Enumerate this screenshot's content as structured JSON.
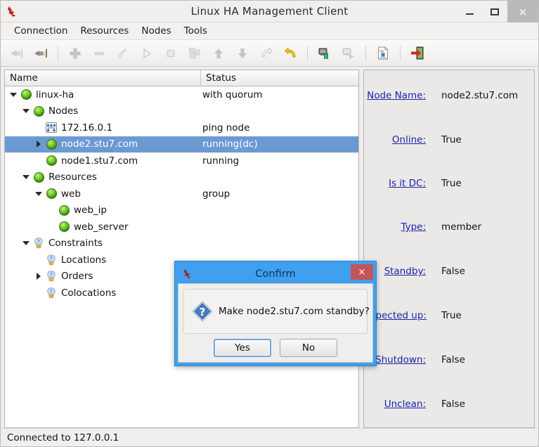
{
  "window": {
    "title": "Linux HA Management Client",
    "app_icon": "linux-ha-icon",
    "minimize_label": "–",
    "maximize_label": "□",
    "close_label": "×"
  },
  "menubar": {
    "items": [
      {
        "label": "Connection"
      },
      {
        "label": "Resources"
      },
      {
        "label": "Nodes"
      },
      {
        "label": "Tools"
      }
    ]
  },
  "toolbar": {
    "buttons": [
      {
        "name": "connect-icon",
        "enabled": false
      },
      {
        "name": "disconnect-icon",
        "enabled": true
      },
      {
        "name": "separator-1",
        "separator": true
      },
      {
        "name": "add-icon",
        "enabled": true
      },
      {
        "name": "remove-icon",
        "enabled": false
      },
      {
        "name": "cleanup-icon",
        "enabled": false
      },
      {
        "name": "start-icon",
        "enabled": false
      },
      {
        "name": "stop-icon",
        "enabled": false
      },
      {
        "name": "manage-icon",
        "enabled": false
      },
      {
        "name": "move-up-icon",
        "enabled": false
      },
      {
        "name": "move-down-icon",
        "enabled": false
      },
      {
        "name": "migrate-icon",
        "enabled": false
      },
      {
        "name": "unmigrate-icon",
        "enabled": true
      },
      {
        "name": "separator-2",
        "separator": true
      },
      {
        "name": "node-standby-icon",
        "enabled": true
      },
      {
        "name": "node-active-icon",
        "enabled": false
      },
      {
        "name": "separator-3",
        "separator": true
      },
      {
        "name": "cib-document-icon",
        "enabled": true
      },
      {
        "name": "separator-4",
        "separator": true
      },
      {
        "name": "exit-icon",
        "enabled": true
      }
    ]
  },
  "tree": {
    "columns": [
      {
        "label": "Name"
      },
      {
        "label": "Status"
      }
    ],
    "rows": [
      {
        "name": "linux-ha",
        "status": "with quorum",
        "indent": 0,
        "twisty": "open",
        "icon": "green-ball",
        "selected": false
      },
      {
        "name": "Nodes",
        "status": "",
        "indent": 1,
        "twisty": "open",
        "icon": "green-ball",
        "selected": false
      },
      {
        "name": "172.16.0.1",
        "status": "ping node",
        "indent": 2,
        "twisty": "none",
        "icon": "ping-node",
        "selected": false
      },
      {
        "name": "node2.stu7.com",
        "status": "running(dc)",
        "indent": 2,
        "twisty": "closed",
        "icon": "green-ball",
        "selected": true
      },
      {
        "name": "node1.stu7.com",
        "status": "running",
        "indent": 2,
        "twisty": "none",
        "icon": "green-ball",
        "selected": false
      },
      {
        "name": "Resources",
        "status": "",
        "indent": 1,
        "twisty": "open",
        "icon": "green-ball",
        "selected": false
      },
      {
        "name": "web",
        "status": "group",
        "indent": 2,
        "twisty": "open",
        "icon": "green-ball",
        "selected": false
      },
      {
        "name": "web_ip",
        "status": "",
        "indent": 3,
        "twisty": "none",
        "icon": "green-ball",
        "selected": false
      },
      {
        "name": "web_server",
        "status": "",
        "indent": 3,
        "twisty": "none",
        "icon": "green-ball",
        "selected": false
      },
      {
        "name": "Constraints",
        "status": "",
        "indent": 1,
        "twisty": "open",
        "icon": "lightbulb",
        "selected": false
      },
      {
        "name": "Locations",
        "status": "",
        "indent": 2,
        "twisty": "none",
        "icon": "lightbulb",
        "selected": false
      },
      {
        "name": "Orders",
        "status": "",
        "indent": 2,
        "twisty": "closed",
        "icon": "lightbulb",
        "selected": false
      },
      {
        "name": "Colocations",
        "status": "",
        "indent": 2,
        "twisty": "none",
        "icon": "lightbulb",
        "selected": false
      }
    ]
  },
  "details": {
    "fields": [
      {
        "key": "Node Name:",
        "value": "node2.stu7.com"
      },
      {
        "key": "Online:",
        "value": "True"
      },
      {
        "key": "Is it DC:",
        "value": "True"
      },
      {
        "key": "Type:",
        "value": "member"
      },
      {
        "key": "Standby:",
        "value": "False"
      },
      {
        "key": "Expected up:",
        "value": "True"
      },
      {
        "key": "Shutdown:",
        "value": "False"
      },
      {
        "key": "Unclean:",
        "value": "False"
      }
    ]
  },
  "statusbar": {
    "text": "Connected to 127.0.0.1"
  },
  "dialog": {
    "title": "Confirm",
    "icon": "linux-ha-icon",
    "close_label": "×",
    "message": "Make node2.stu7.com standby?",
    "question_icon": "question-mark-icon",
    "buttons": [
      {
        "label": "Yes",
        "focused": true
      },
      {
        "label": "No",
        "focused": false
      }
    ]
  },
  "colors": {
    "selection": "#6b9ad2",
    "dialog_frame": "#3ea0ee",
    "dialog_close": "#c4545b",
    "link": "#1c21a8",
    "node_green": "#76cc2a"
  }
}
